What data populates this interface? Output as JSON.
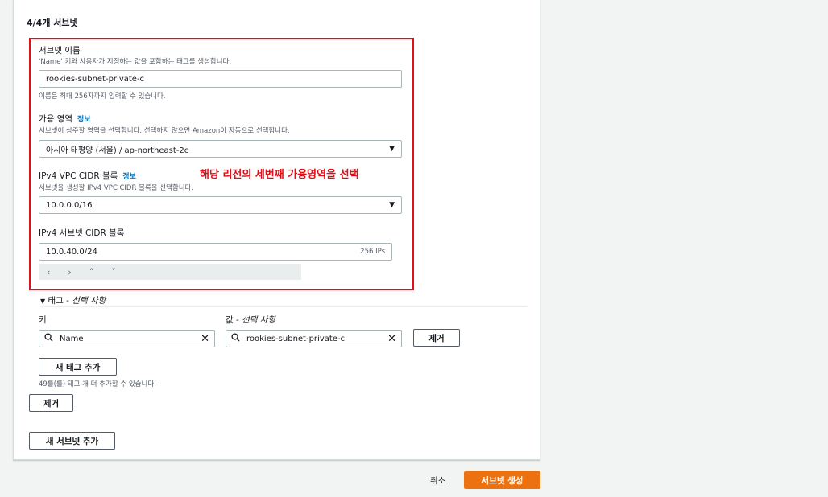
{
  "section_title": "4/4개 서브넷",
  "subnet_name": {
    "label": "서브넷 이름",
    "description": "'Name' 키와 사용자가 지정하는 값을 포함하는 태그를 생성합니다.",
    "value": "rookies-subnet-private-c",
    "hint": "이름은 최대 256자까지 입력할 수 있습니다."
  },
  "availability_zone": {
    "label": "가용 영역",
    "info": "정보",
    "description": "서브넷이 상주할 영역을 선택합니다. 선택하지 않으면 Amazon이 자동으로 선택합니다.",
    "value": "아시아 태평양 (서울) / ap-northeast-2c"
  },
  "vpc_cidr": {
    "label": "IPv4 VPC CIDR 블록",
    "info": "정보",
    "description": "서브넷을 생성할 IPv4 VPC CIDR 블록을 선택합니다.",
    "value": "10.0.0.0/16"
  },
  "annotation": "해당 리전의 세번째 가용영역을 선택",
  "subnet_cidr": {
    "label": "IPv4 서브넷 CIDR 블록",
    "value": "10.0.40.0/24",
    "ips": "256 IPs",
    "nav": {
      "prev": "‹",
      "next": "›",
      "up": "˄",
      "down": "˅"
    }
  },
  "tags": {
    "header": "태그 - ",
    "header_optional": "선택 사항",
    "key_label": "키",
    "value_label": "값 - ",
    "value_label_optional": "선택 사항",
    "key_value": "Name",
    "value_value": "rookies-subnet-private-c",
    "remove_tag": "제거",
    "add_tag": "새 태그 추가",
    "remaining": "49를(를) 태그 개 더 추가할 수 있습니다."
  },
  "remove_subnet": "제거",
  "add_subnet": "새 서브넷 추가",
  "footer": {
    "cancel": "취소",
    "create": "서브넷 생성"
  },
  "colors": {
    "accent": "#ec7211",
    "link": "#0073bb",
    "annotation": "#e0101a"
  }
}
